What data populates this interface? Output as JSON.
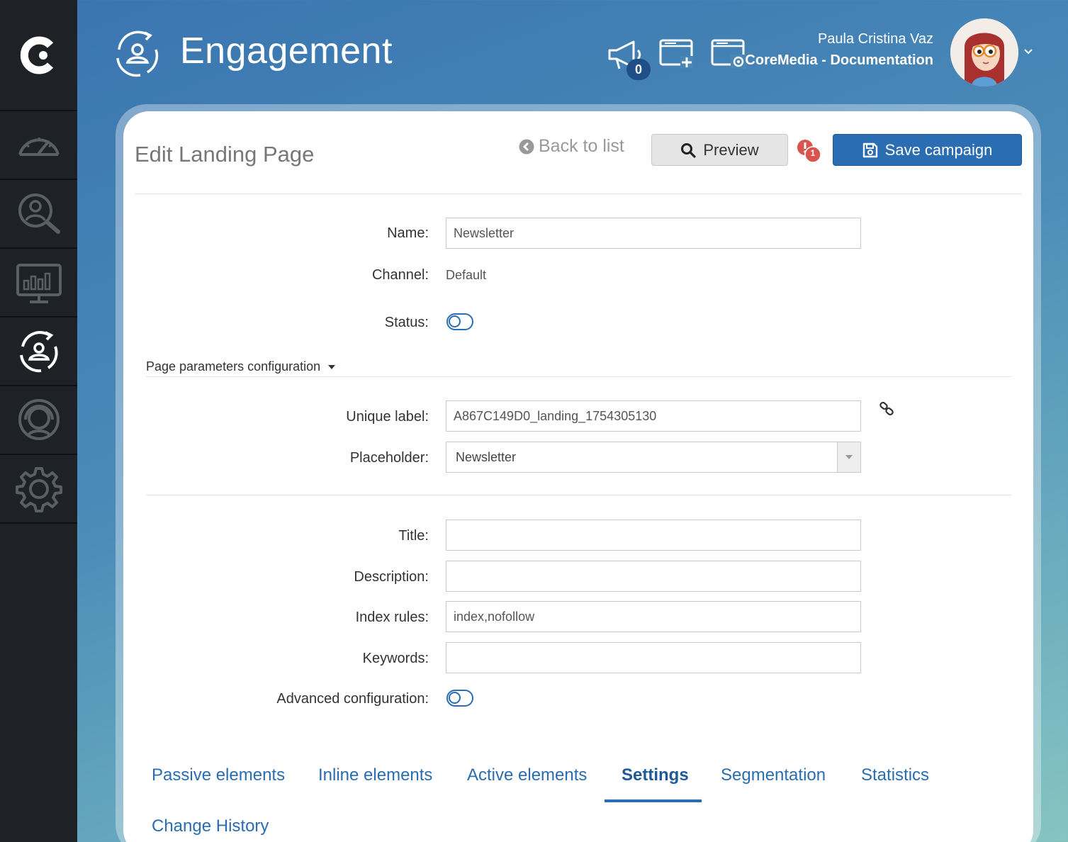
{
  "app": {
    "title": "Engagement",
    "notification_count": "0"
  },
  "user": {
    "name": "Paula Cristina Vaz",
    "organization": "CoreMedia - Documentation"
  },
  "sidebar": {
    "items": [
      {
        "name": "dashboard",
        "icon": "speedometer-icon"
      },
      {
        "name": "profiles",
        "icon": "user-search-icon"
      },
      {
        "name": "analytics",
        "icon": "monitor-chart-icon"
      },
      {
        "name": "engagement",
        "icon": "engagement-cycle-icon",
        "active": true
      },
      {
        "name": "support",
        "icon": "headset-user-icon"
      },
      {
        "name": "settings",
        "icon": "gear-icon"
      }
    ]
  },
  "page": {
    "heading": "Edit Landing Page",
    "back_label": "Back to list",
    "preview_label": "Preview",
    "alert_count": "1",
    "save_label": "Save campaign"
  },
  "form": {
    "name_label": "Name:",
    "name_value": "Newsletter",
    "channel_label": "Channel:",
    "channel_value": "Default",
    "status_label": "Status:",
    "status_on": false,
    "section_label": "Page parameters configuration",
    "unique_label_label": "Unique label:",
    "unique_label_value": "A867C149D0_landing_1754305130",
    "placeholder_label": "Placeholder:",
    "placeholder_value": "Newsletter",
    "title_label": "Title:",
    "title_value": "",
    "description_label": "Description:",
    "description_value": "",
    "index_rules_label": "Index rules:",
    "index_rules_value": "index,nofollow",
    "keywords_label": "Keywords:",
    "keywords_value": "",
    "advanced_label": "Advanced configuration:",
    "advanced_on": false
  },
  "tabs": [
    {
      "label": "Passive elements",
      "active": false
    },
    {
      "label": "Inline elements",
      "active": false
    },
    {
      "label": "Active elements",
      "active": false
    },
    {
      "label": "Settings",
      "active": true
    },
    {
      "label": "Segmentation",
      "active": false
    },
    {
      "label": "Statistics",
      "active": false
    },
    {
      "label": "Change History",
      "active": false
    }
  ],
  "colors": {
    "accent": "#2a6db2",
    "sidebar_bg": "#1e2126",
    "alert": "#d9534f"
  }
}
